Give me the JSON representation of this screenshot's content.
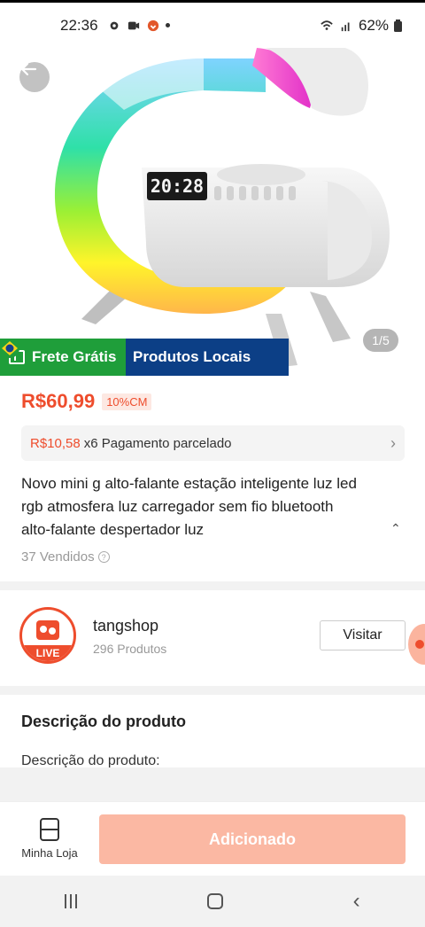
{
  "status_bar": {
    "time": "22:36",
    "battery": "62%"
  },
  "gallery": {
    "counter": "1/5",
    "clock_display": "20:28"
  },
  "badges": {
    "free_shipping": "Frete Grátis",
    "local_products": "Produtos Locais"
  },
  "product": {
    "price": "R$60,99",
    "cm_tag": "10%CM",
    "installment_amount": "R$10,58",
    "installment_text": "x6 Pagamento parcelado",
    "title": "Novo mini g alto-falante estação inteligente luz led rgb atmosfera luz carregador sem fio bluetooth alto-falante despertador luz",
    "sold": "37 Vendidos"
  },
  "shop": {
    "live_label": "LIVE",
    "name": "tangshop",
    "products": "296 Produtos",
    "visit_label": "Visitar"
  },
  "description": {
    "title": "Descrição do produto",
    "subtitle": "Descrição do produto:"
  },
  "bottom_bar": {
    "shop_label": "Minha Loja",
    "add_label": "Adicionado"
  },
  "colors": {
    "accent": "#ee4d2d",
    "free_shipping_bg": "#1f9e3a",
    "local_bg": "#0c3f86",
    "add_button_bg": "#fbb8a3"
  },
  "icons": [
    "gear-icon",
    "video-icon",
    "notification-icon",
    "wifi-icon",
    "signal-icon",
    "battery-icon",
    "back-arrow-icon",
    "truck-icon",
    "brazil-flag-icon",
    "chevron-right-icon",
    "chevron-up-icon",
    "help-icon",
    "store-icon",
    "recents-icon",
    "home-icon",
    "nav-back-icon"
  ]
}
